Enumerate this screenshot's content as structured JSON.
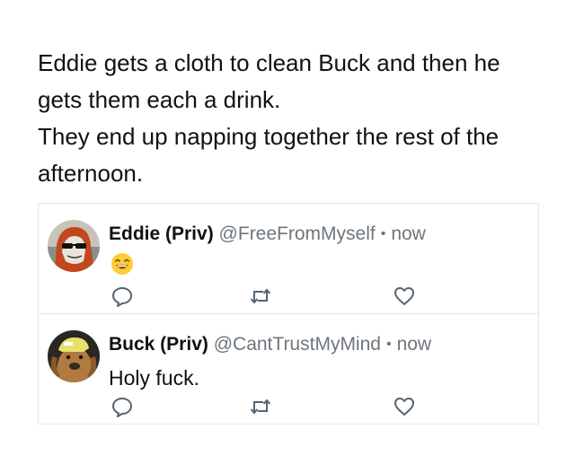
{
  "narrative": {
    "line1": "Eddie gets a cloth to clean Buck and then he gets them each a drink.",
    "line2": "They end up napping together the rest of the afternoon."
  },
  "tweets": [
    {
      "name": "Eddie (Priv)",
      "handle": "@FreeFromMyself",
      "separator": "•",
      "time": "now",
      "content_emoji": "grinning-face-with-smiling-eyes",
      "avatar": "eddie-avatar"
    },
    {
      "name": "Buck (Priv)",
      "handle": "@CantTrustMyMind",
      "separator": "•",
      "time": "now",
      "content": "Holy fuck.",
      "avatar": "buck-dog-avatar"
    }
  ],
  "icons": {
    "reply": "reply-icon",
    "retweet": "retweet-icon",
    "like": "heart-icon"
  },
  "colors": {
    "text": "#111111",
    "secondary": "#6e767d",
    "border": "#e6e6e6",
    "icon": "#536471"
  }
}
